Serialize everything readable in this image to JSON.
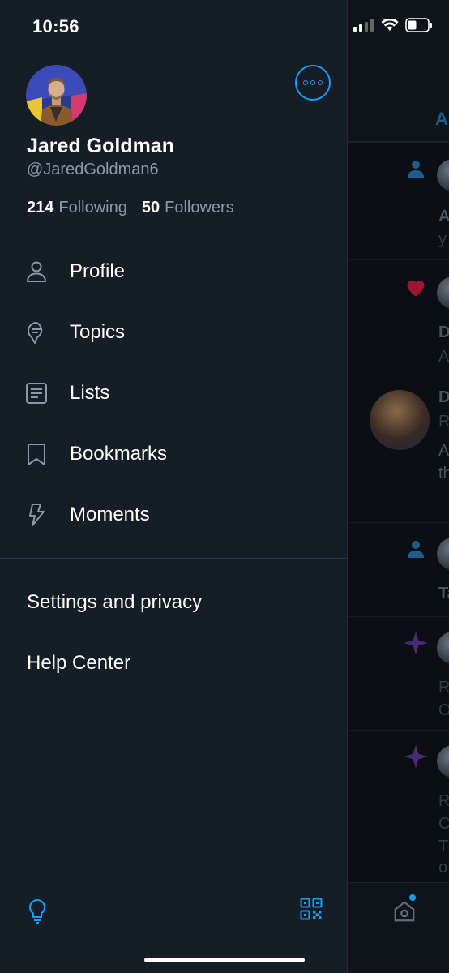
{
  "status_bar": {
    "time": "10:56"
  },
  "profile": {
    "name": "Jared Goldman",
    "handle": "@JaredGoldman6",
    "following_count": "214",
    "following_label": "Following",
    "followers_count": "50",
    "followers_label": "Followers"
  },
  "menu": [
    {
      "label": "Profile",
      "icon": "person-icon"
    },
    {
      "label": "Topics",
      "icon": "topics-icon"
    },
    {
      "label": "Lists",
      "icon": "list-icon"
    },
    {
      "label": "Bookmarks",
      "icon": "bookmark-icon"
    },
    {
      "label": "Moments",
      "icon": "lightning-icon"
    }
  ],
  "secondary_menu": {
    "settings": "Settings and privacy",
    "help": "Help Center"
  },
  "background_timeline": {
    "tab_fragment": "A",
    "rows": [
      {
        "line1": "A",
        "line2": "y"
      },
      {
        "line1": "D",
        "line2": "A"
      },
      {
        "line1": "D",
        "line2": "R",
        "line3": "A",
        "line4": "th"
      },
      {
        "line1": "Ta"
      },
      {
        "line1": "R",
        "line2": "O"
      },
      {
        "line1": "R",
        "line2": "C",
        "line3": "T",
        "line4": "o"
      }
    ]
  },
  "colors": {
    "accent": "#1d9bf0",
    "drawer_bg": "#151d27",
    "secondary_text": "#8b98a5"
  }
}
